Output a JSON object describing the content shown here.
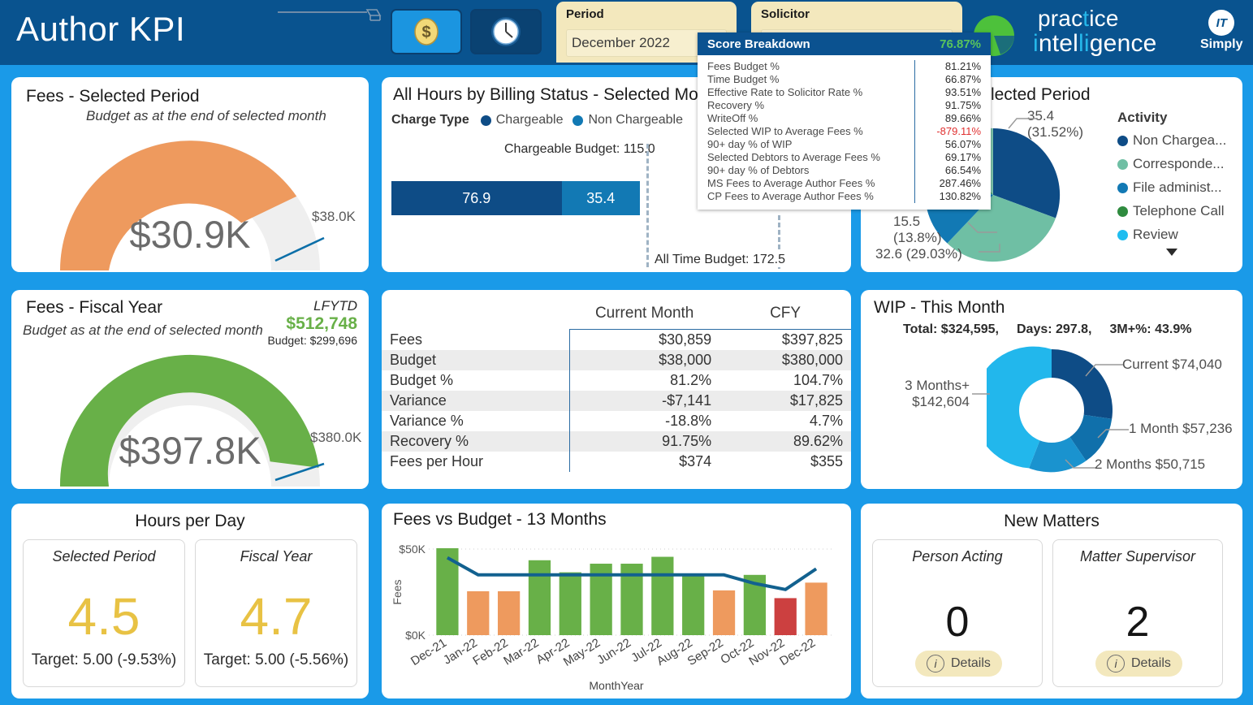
{
  "header": {
    "title": "Author KPI",
    "toggle_money_icon": "dollar-coin-icon",
    "toggle_time_icon": "clock-icon",
    "period": {
      "label": "Period",
      "value": "December 2022"
    },
    "solicitor": {
      "label": "Solicitor",
      "value": ""
    },
    "logo_line1": "practice",
    "logo_line2": "intelligence",
    "badge_text": "IT",
    "badge_word": "Simply"
  },
  "tooltip": {
    "title": "Score Breakdown",
    "score": "76.87%",
    "rows": [
      {
        "label": "Fees Budget %",
        "value": "81.21%",
        "negative": false
      },
      {
        "label": "Time Budget %",
        "value": "66.87%",
        "negative": false
      },
      {
        "label": "Effective Rate to Solicitor Rate %",
        "value": "93.51%",
        "negative": false
      },
      {
        "label": "Recovery %",
        "value": "91.75%",
        "negative": false
      },
      {
        "label": "WriteOff %",
        "value": "89.66%",
        "negative": false
      },
      {
        "label": "Selected WIP to Average Fees %",
        "value": "-879.11%",
        "negative": true
      },
      {
        "label": "90+ day % of WIP",
        "value": "56.07%",
        "negative": false
      },
      {
        "label": "Selected Debtors to Average Fees %",
        "value": "69.17%",
        "negative": false
      },
      {
        "label": "90+ day % of Debtors",
        "value": "66.54%",
        "negative": false
      },
      {
        "label": "MS Fees to Average Author Fees %",
        "value": "287.46%",
        "negative": false
      },
      {
        "label": "CP Fees to Average Author Fees %",
        "value": "130.82%",
        "negative": false
      }
    ]
  },
  "fees_selected": {
    "title": "Fees - Selected Period",
    "subtitle": "Budget as at the end of selected month",
    "value": "$30.9K",
    "target": "$38.0K",
    "percent": 81.2,
    "color": "#ee9a5e"
  },
  "fees_fiscal": {
    "title": "Fees - Fiscal Year",
    "subtitle": "Budget as at the end of selected month",
    "lfytd_label": "LFYTD",
    "lfytd_value": "$512,748",
    "lfytd_budget": "Budget: $299,696",
    "value": "$397.8K",
    "target": "$380.0K",
    "percent": 104.7,
    "color": "#68b048"
  },
  "hours_bar": {
    "title": "All Hours by Billing Status - Selected Month",
    "legend_title": "Charge Type",
    "legend": [
      {
        "label": "Chargeable",
        "color": "#0e4c86"
      },
      {
        "label": "Non Chargeable",
        "color": "#1279b4"
      }
    ],
    "chargeable_budget_label": "Chargeable Budget: 115.0",
    "all_time_budget_label": "All Time Budget: 172.5",
    "segments": [
      {
        "label": "76.9",
        "value": 76.9,
        "color": "#0e4c86"
      },
      {
        "label": "35.4",
        "value": 35.4,
        "color": "#1279b4"
      }
    ]
  },
  "work_type": {
    "title": "Work Type - Selected Period",
    "legend_title": "Activity",
    "labels": [
      "35.4\n(31.52%)",
      "15.5\n(13.8%)",
      "32.6 (29.03%)"
    ],
    "label_1a": "35.4",
    "label_1b": "(31.52%)",
    "label_2a": "15.5",
    "label_2b": "(13.8%)",
    "label_3": "32.6 (29.03%)",
    "legend": [
      {
        "label": "Non Chargea...",
        "color": "#0e4c86"
      },
      {
        "label": "Corresponde...",
        "color": "#6fbfa4"
      },
      {
        "label": "File administ...",
        "color": "#1279b4"
      },
      {
        "label": "Telephone Call",
        "color": "#2f8b3f"
      },
      {
        "label": "Review",
        "color": "#1fbdf0"
      }
    ]
  },
  "kpi_table": {
    "headers": [
      "",
      "Current Month",
      "CFY"
    ],
    "rows": [
      {
        "label": "Fees",
        "current": "$30,859",
        "cfy": "$397,825",
        "cur_class": "",
        "cfy_class": ""
      },
      {
        "label": "Budget",
        "current": "$38,000",
        "cfy": "$380,000",
        "cur_class": "",
        "cfy_class": ""
      },
      {
        "label": "Budget %",
        "current": "81.2%",
        "cfy": "104.7%",
        "cur_class": "neg",
        "cfy_class": "pos"
      },
      {
        "label": "Variance",
        "current": "-$7,141",
        "cfy": "$17,825",
        "cur_class": "",
        "cfy_class": ""
      },
      {
        "label": "Variance %",
        "current": "-18.8%",
        "cfy": "4.7%",
        "cur_class": "neg",
        "cfy_class": "pos"
      },
      {
        "label": "Recovery %",
        "current": "91.75%",
        "cfy": "89.62%",
        "cur_class": "",
        "cfy_class": ""
      },
      {
        "label": "Fees per Hour",
        "current": "$374",
        "cfy": "$355",
        "cur_class": "",
        "cfy_class": ""
      }
    ]
  },
  "wip": {
    "title": "WIP - This Month",
    "total": "Total: $324,595,",
    "days": "Days: 297.8,",
    "threeplus": "3M+%: 43.9%",
    "slices": [
      {
        "label": "Current $74,040",
        "value": 74040,
        "color": "#0e4c86"
      },
      {
        "label": "1 Month $57,236",
        "value": 57236,
        "color": "#1070ab"
      },
      {
        "label": "2 Months $50,715",
        "value": 50715,
        "color": "#1a93cf"
      },
      {
        "label": "3 Months+ $142,604",
        "value": 142604,
        "color": "#22b7ec"
      }
    ],
    "label_3m_line1": "3 Months+",
    "label_3m_line2": "$142,604"
  },
  "hours_per_day": {
    "title": "Hours per Day",
    "tiles": [
      {
        "header": "Selected Period",
        "value": "4.5",
        "sub": "Target: 5.00 (-9.53%)"
      },
      {
        "header": "Fiscal Year",
        "value": "4.7",
        "sub": "Target: 5.00 (-5.56%)"
      }
    ]
  },
  "new_matters": {
    "title": "New Matters",
    "tiles": [
      {
        "header": "Person Acting",
        "value": "0",
        "details": "Details"
      },
      {
        "header": "Matter Supervisor",
        "value": "2",
        "details": "Details"
      }
    ]
  },
  "chart_data": {
    "type": "bar",
    "title": "Fees vs Budget - 13 Months",
    "xlabel": "MonthYear",
    "ylabel": "Fees",
    "ylim": [
      0,
      50000
    ],
    "yticks": [
      "$0K",
      "$50K"
    ],
    "categories": [
      "Dec-21",
      "Jan-22",
      "Feb-22",
      "Mar-22",
      "Apr-22",
      "May-22",
      "Jun-22",
      "Jul-22",
      "Aug-22",
      "Sep-22",
      "Oct-22",
      "Nov-22",
      "Dec-22"
    ],
    "values": [
      50500,
      25500,
      25500,
      43500,
      36500,
      41500,
      41500,
      45500,
      35500,
      26000,
      35000,
      21500,
      30500
    ],
    "bar_colors": [
      "#68b048",
      "#ee9a5e",
      "#ee9a5e",
      "#68b048",
      "#68b048",
      "#68b048",
      "#68b048",
      "#68b048",
      "#68b048",
      "#ee9a5e",
      "#68b048",
      "#cc4040",
      "#ee9a5e"
    ],
    "series": [
      {
        "name": "Budget",
        "type": "line",
        "color": "#12618f",
        "values": [
          45000,
          35000,
          35000,
          35000,
          35000,
          35000,
          35000,
          35000,
          35000,
          35000,
          30000,
          26500,
          38500
        ]
      }
    ],
    "grid": true,
    "legend": "none"
  }
}
